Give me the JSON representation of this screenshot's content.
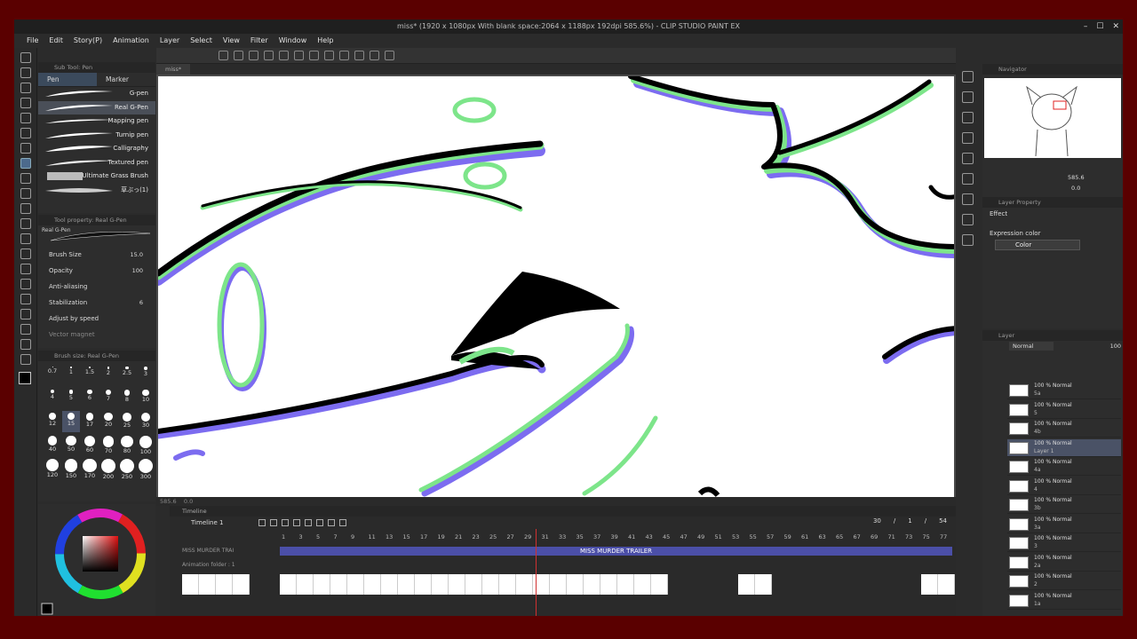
{
  "window": {
    "title": "miss* (1920 x 1080px With blank space:2064 x 1188px 192dpi 585.6%) - CLIP STUDIO PAINT EX"
  },
  "menu": [
    "File",
    "Edit",
    "Story(P)",
    "Animation",
    "Layer",
    "Select",
    "View",
    "Filter",
    "Window",
    "Help"
  ],
  "canvas_tab": "miss*",
  "subtool": {
    "header": "Sub Tool: Pen",
    "tabs": [
      "Pen",
      "Marker"
    ],
    "brushes": [
      "G-pen",
      "Real G-Pen",
      "Mapping pen",
      "Turnip pen",
      "Calligraphy",
      "Textured pen",
      "Ultimate Grass Brush",
      "草ぶっ(1)"
    ]
  },
  "tool_property": {
    "header": "Tool property: Real G-Pen",
    "preview_name": "Real G-Pen",
    "brush_size_label": "Brush Size",
    "brush_size": "15.0",
    "opacity_label": "Opacity",
    "opacity": "100",
    "antialias_label": "Anti-aliasing",
    "stabilization_label": "Stabilization",
    "stabilization": "6",
    "adjust_label": "Adjust by speed",
    "vector_label": "Vector magnet"
  },
  "brush_size_panel": {
    "header": "Brush size: Real G-Pen",
    "sizes": [
      "0.7",
      "1",
      "1.5",
      "2",
      "2.5",
      "3",
      "4",
      "5",
      "6",
      "7",
      "8",
      "10",
      "12",
      "15",
      "17",
      "20",
      "25",
      "30",
      "40",
      "50",
      "60",
      "70",
      "80",
      "100",
      "120",
      "150",
      "170",
      "200",
      "250",
      "300"
    ]
  },
  "status": {
    "zoom": "585.6",
    "angle": "0.0"
  },
  "timeline": {
    "header": "Timeline",
    "name": "Timeline 1",
    "frame_current": "30",
    "frame_start": "1",
    "frame_end": "54",
    "track1_label": "MISS MURDER TRAI",
    "track2_label": "Animation folder : 1",
    "track_title": "MISS MURDER TRAILER",
    "ruler": [
      "1",
      "3",
      "5",
      "7",
      "9",
      "11",
      "13",
      "15",
      "17",
      "19",
      "21",
      "23",
      "25",
      "27",
      "29",
      "31",
      "33",
      "35",
      "37",
      "39",
      "41",
      "43",
      "45",
      "47",
      "49",
      "51",
      "53",
      "55",
      "57",
      "59",
      "61",
      "63",
      "65",
      "67",
      "69",
      "71",
      "73",
      "75",
      "77"
    ]
  },
  "navigator": {
    "header": "Navigator",
    "zoom": "585.6",
    "angle": "0.0"
  },
  "layer_property": {
    "header": "Layer Property",
    "effect_label": "Effect",
    "expression_label": "Expression color",
    "expression_value": "Color"
  },
  "layers": {
    "header": "Layer",
    "blend": "Normal",
    "opacity": "100",
    "rows": [
      {
        "mode": "100 % Normal",
        "name": "5a"
      },
      {
        "mode": "100 % Normal",
        "name": "5"
      },
      {
        "mode": "100 % Normal",
        "name": "4b"
      },
      {
        "mode": "100 % Normal",
        "name": "Layer 1"
      },
      {
        "mode": "100 % Normal",
        "name": "4a"
      },
      {
        "mode": "100 % Normal",
        "name": "4"
      },
      {
        "mode": "100 % Normal",
        "name": "3b"
      },
      {
        "mode": "100 % Normal",
        "name": "3a"
      },
      {
        "mode": "100 % Normal",
        "name": "3"
      },
      {
        "mode": "100 % Normal",
        "name": "2a"
      },
      {
        "mode": "100 % Normal",
        "name": "2"
      },
      {
        "mode": "100 % Normal",
        "name": "1a"
      }
    ]
  },
  "colors": {
    "frame": "#5a0000",
    "panel": "#2d2d2d",
    "lineart_green": "#7de58a",
    "lineart_purple": "#7c6cf0",
    "selection": "#4a5266"
  }
}
